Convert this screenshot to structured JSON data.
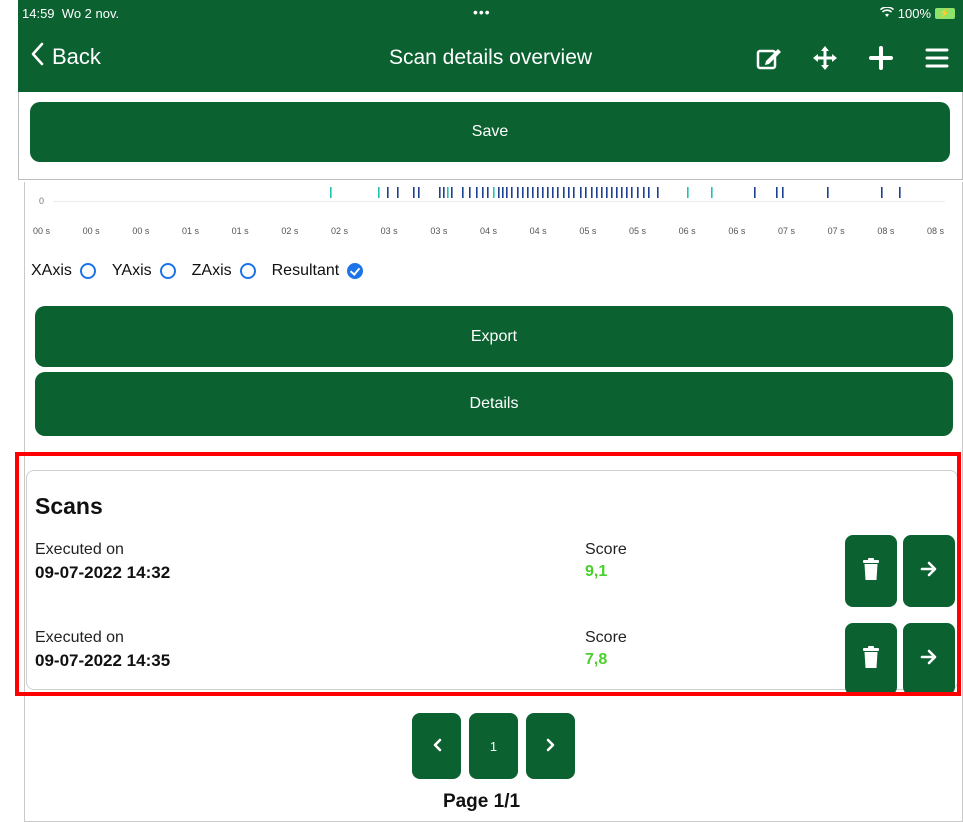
{
  "status_bar": {
    "time": "14:59",
    "date": "Wo 2 nov.",
    "dots": "•••",
    "battery": "100%"
  },
  "nav": {
    "back_label": "Back",
    "title": "Scan details overview"
  },
  "save_label": "Save",
  "chart_data": {
    "type": "bar",
    "y_tick": "0",
    "x_ticks": [
      "00 s",
      "00 s",
      "00 s",
      "01 s",
      "01 s",
      "02 s",
      "02 s",
      "03 s",
      "03 s",
      "04 s",
      "04 s",
      "05 s",
      "05 s",
      "06 s",
      "06 s",
      "07 s",
      "07 s",
      "08 s",
      "08 s"
    ]
  },
  "axes_options": [
    {
      "label": "XAxis",
      "checked": false
    },
    {
      "label": "YAxis",
      "checked": false
    },
    {
      "label": "ZAxis",
      "checked": false
    },
    {
      "label": "Resultant",
      "checked": true
    }
  ],
  "export_label": "Export",
  "details_label": "Details",
  "scans": {
    "title": "Scans",
    "rows": [
      {
        "executed_label": "Executed on",
        "date": "09-07-2022 14:32",
        "score_label": "Score",
        "score": "9,1"
      },
      {
        "executed_label": "Executed on",
        "date": "09-07-2022 14:35",
        "score_label": "Score",
        "score": "7,8"
      }
    ]
  },
  "pagination": {
    "current": "1",
    "page_label": "Page 1/1"
  },
  "colors": {
    "primary": "#0b6130",
    "score": "#49d02a",
    "radio": "#1d74e6",
    "highlight": "#ff0000"
  },
  "icons": {
    "back": "chevron-left-icon",
    "edit": "edit-icon",
    "move": "move-icon",
    "add": "plus-icon",
    "menu": "menu-icon",
    "delete": "trash-icon",
    "open": "arrow-right-icon"
  }
}
